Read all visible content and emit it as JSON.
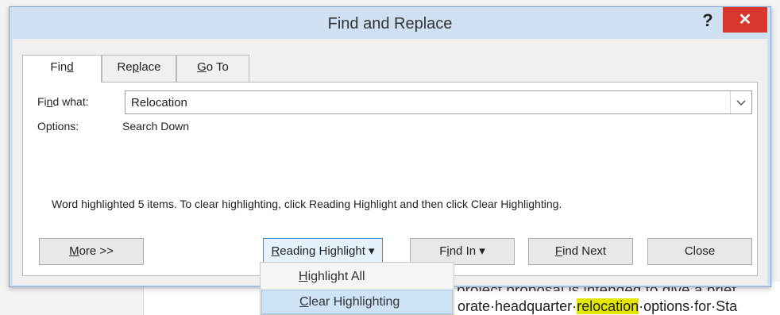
{
  "window": {
    "title": "Find and Replace",
    "help": "?",
    "close": "✕"
  },
  "tabs": [
    {
      "pre": "Fin",
      "ul": "d",
      "post": ""
    },
    {
      "pre": "Re",
      "ul": "p",
      "post": "lace"
    },
    {
      "pre": "",
      "ul": "G",
      "post": "o To"
    }
  ],
  "find": {
    "label_pre": "Fi",
    "label_ul": "n",
    "label_post": "d what:",
    "value": "Relocation",
    "dropdown_icon": "chevron-down"
  },
  "options": {
    "label": "Options:",
    "value": "Search Down"
  },
  "message": "Word highlighted 5 items. To clear highlighting, click Reading Highlight and then click Clear Highlighting.",
  "buttons": {
    "more": {
      "ul": "M",
      "post": "ore >>"
    },
    "reading_highlight": {
      "pre": "",
      "ul": "R",
      "post": "eading Highlight ▾"
    },
    "find_in": {
      "pre": "F",
      "ul": "i",
      "post": "nd In ▾"
    },
    "find_next": {
      "pre": "",
      "ul": "F",
      "post": "ind Next"
    },
    "close": "Close"
  },
  "menu": [
    {
      "ul": "H",
      "post": "ighlight All"
    },
    {
      "ul": "C",
      "post": "lear Highlighting"
    }
  ],
  "document": {
    "line1": "project proposal is intended to give a brief",
    "line2_pre": "orate·headquarter·",
    "line2_hl": "relocation",
    "line2_post": "·options·for·Sta"
  }
}
